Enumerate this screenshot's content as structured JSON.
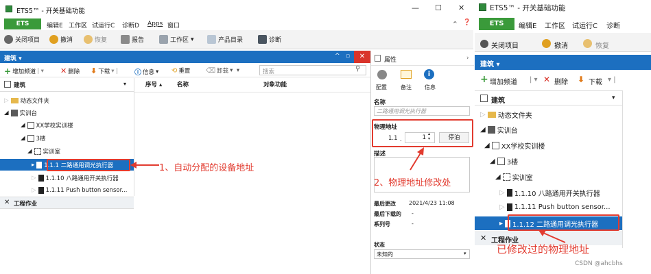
{
  "window": {
    "title": "ETS5™ - 开关基础功能",
    "min": "—",
    "max": "☐",
    "close": "✕"
  },
  "menu": {
    "ets": "ETS",
    "items": [
      "编辑E",
      "工作区",
      "试运行C",
      "诊断D",
      "Apps",
      "窗口"
    ],
    "help": "❓"
  },
  "ribbon": {
    "close_project": "关闭项目",
    "undo": "撤消",
    "redo": "恢复",
    "report": "报告",
    "workspace": "工作区",
    "catalog": "产品目录",
    "diagnostics": "诊断"
  },
  "building_panel": {
    "title": "建筑 ▾",
    "toolbar": {
      "add_channel": "增加频道",
      "delete": "删除",
      "download": "下载",
      "info": "信息",
      "reset": "重置",
      "unload": "卸载",
      "search_placeholder": "搜索"
    },
    "tree_header": "建筑",
    "columns": [
      "序号 ▴",
      "名称",
      "对象功能"
    ],
    "tree": [
      {
        "label": "动态文件夹"
      },
      {
        "label": "实训台"
      },
      {
        "label": "XX学校实训楼"
      },
      {
        "label": "3楼"
      },
      {
        "label": "实训室"
      },
      {
        "label": "1.1.1 二路通用调光执行器"
      },
      {
        "label": "1.1.10 八路通用开关执行器"
      },
      {
        "label": "1.1.11 Push button sensor..."
      }
    ],
    "work_section": "工程作业"
  },
  "properties": {
    "title": "属性",
    "tabs": [
      "配置",
      "备注",
      "信息"
    ],
    "name_label": "名称",
    "name_placeholder": "二路通用调光执行器",
    "phys_addr_label": "物理地址",
    "addr_prefix": "1.1",
    "addr_sep": ".",
    "addr_value": "1",
    "park_button": "停泊",
    "description_label": "描述",
    "last_modified_label": "最后更改",
    "last_modified_value": "2021/4/23 11:08",
    "last_download_label": "最后下载的",
    "last_download_value": "-",
    "serial_label": "系列号",
    "serial_value": "-",
    "status_label": "状态",
    "status_value": "未知的"
  },
  "annotations": {
    "auto_addr": "1、自动分配的设备地址",
    "modify_addr": "2、物理地址修改处",
    "modified_addr": "已修改过的物理地址"
  },
  "right_screenshot": {
    "title": "ETS5™ - 开关基础功能",
    "ets": "ETS",
    "menu": [
      "编辑E",
      "工作区",
      "试运行C",
      "诊断"
    ],
    "close_project": "关闭项目",
    "undo": "撤消",
    "redo": "恢复",
    "panel_title": "建筑 ▾",
    "add_channel": "增加频道",
    "delete": "删除",
    "download": "下载",
    "tree_header": "建筑",
    "tree": [
      {
        "label": "动态文件夹"
      },
      {
        "label": "实训台"
      },
      {
        "label": "XX学校实训楼"
      },
      {
        "label": "3楼"
      },
      {
        "label": "实训室"
      },
      {
        "label": "1.1.10 八路通用开关执行器"
      },
      {
        "label": "1.1.11 Push button sensor..."
      },
      {
        "label": "1.1.12 二路通用调光执行器"
      }
    ],
    "work_section": "工程作业"
  },
  "watermark": "CSDN @ahcbhs",
  "colors": {
    "accent_blue": "#1c6fc0",
    "ets_green": "#3a9a3a",
    "annotation_red": "#e23b2f"
  }
}
